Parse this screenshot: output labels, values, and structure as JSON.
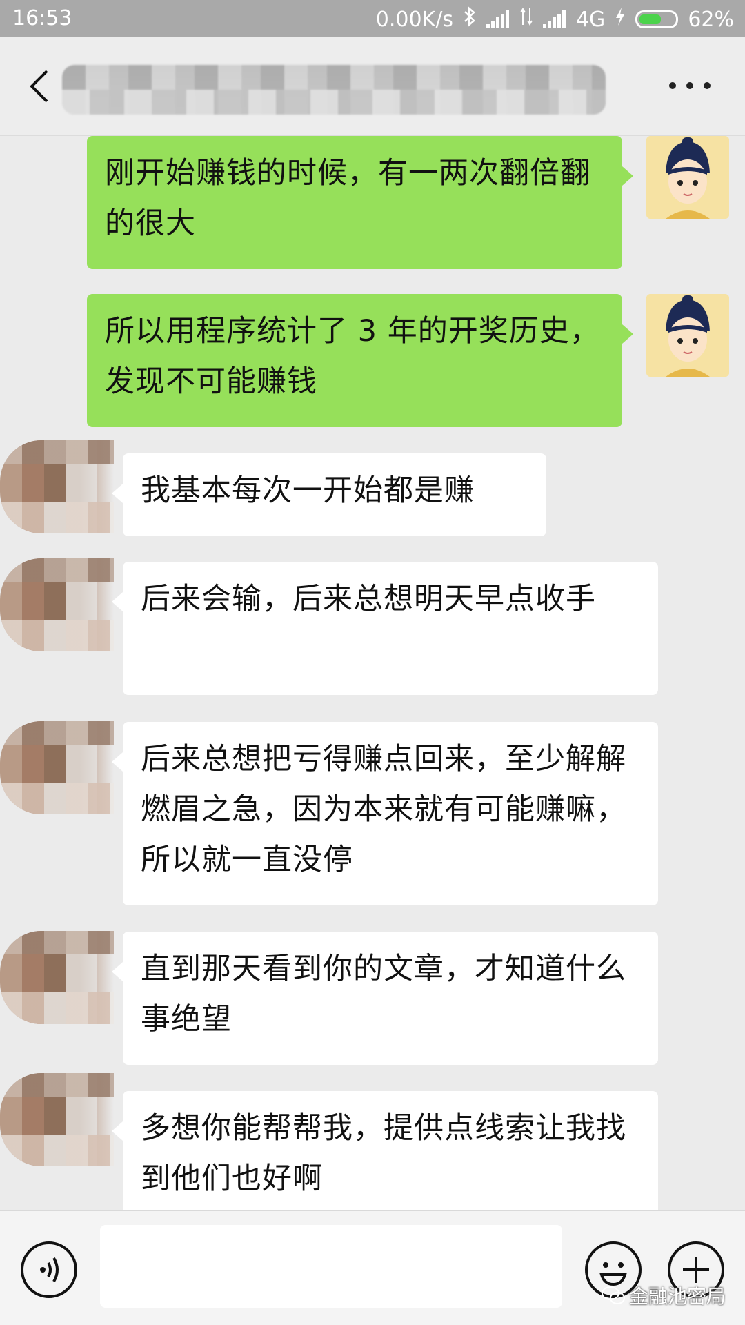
{
  "status_bar": {
    "time": "16:53",
    "net_speed": "0.00K/s",
    "network": "4G",
    "battery": "62%",
    "battery_level": 0.62,
    "battery_color": "#4cd34c"
  },
  "header": {
    "back_icon": "chevron-left-icon",
    "more_icon": "more-dots-icon"
  },
  "messages": [
    {
      "sender": "me",
      "text": "刚开始赚钱的时候，有一两次翻倍翻的很大"
    },
    {
      "sender": "me",
      "text": "所以用程序统计了 3 年的开奖历史，发现不可能赚钱"
    },
    {
      "sender": "other",
      "text": "我基本每次一开始都是赚"
    },
    {
      "sender": "other",
      "text": "后来会输，后来总想明天早点收手"
    },
    {
      "sender": "other",
      "text": "后来总想把亏得赚点回来，至少解解燃眉之急，因为本来就有可能赚嘛，所以就一直没停"
    },
    {
      "sender": "other",
      "text": "直到那天看到你的文章，才知道什么事绝望"
    },
    {
      "sender": "other",
      "text": "多想你能帮帮我，提供点线索让我找到他们也好啊"
    }
  ],
  "input_bar": {
    "voice_icon": "voice-icon",
    "emoji_icon": "emoji-icon",
    "plus_icon": "plus-icon",
    "watermark": "金融池密局"
  },
  "colors": {
    "my_bubble": "#96e05a",
    "other_bubble": "#ffffff",
    "chat_bg": "#ebebeb"
  }
}
